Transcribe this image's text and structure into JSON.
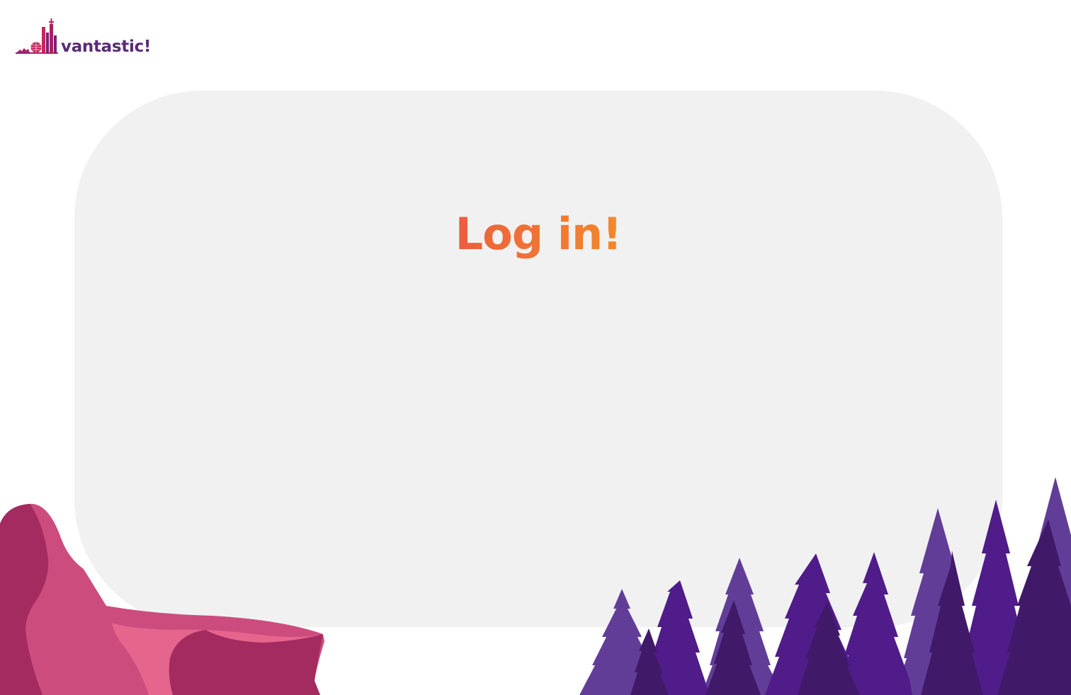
{
  "brand": {
    "name": "vantastic!",
    "logo_icon": "city-skyline-icon",
    "colors": {
      "purple": "#5a2a78",
      "magenta": "#b2205a",
      "orange": "#f38b2a"
    }
  },
  "login": {
    "title": "Log in!"
  },
  "decor": {
    "left_illustration": "pink-rocks-illustration",
    "right_illustration": "purple-pine-forest-illustration"
  }
}
